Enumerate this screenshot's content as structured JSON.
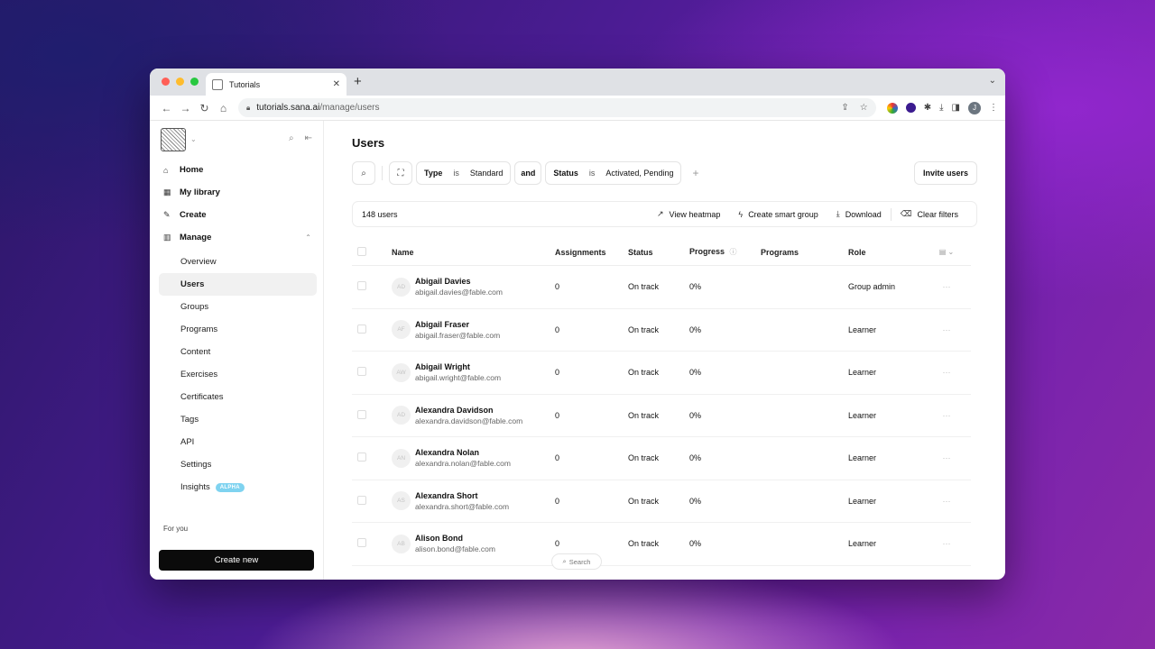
{
  "browser": {
    "tab_title": "Tutorials",
    "url_host": "tutorials.sana.ai",
    "url_path": "/manage/users",
    "profile_initial": "J"
  },
  "sidebar": {
    "nav": [
      {
        "label": "Home",
        "icon": "home-icon"
      },
      {
        "label": "My library",
        "icon": "library-icon"
      },
      {
        "label": "Create",
        "icon": "pencil-icon"
      },
      {
        "label": "Manage",
        "icon": "manage-icon"
      }
    ],
    "manage_items": [
      "Overview",
      "Users",
      "Groups",
      "Programs",
      "Content",
      "Exercises",
      "Certificates",
      "Tags",
      "API",
      "Settings",
      "Insights"
    ],
    "insights_badge": "ALPHA",
    "for_you": "For you",
    "create_new": "Create new"
  },
  "main": {
    "title": "Users",
    "filters": {
      "type_field": "Type",
      "type_op": "is",
      "type_value": "Standard",
      "conjunction": "and",
      "status_field": "Status",
      "status_op": "is",
      "status_value": "Activated, Pending"
    },
    "invite": "Invite users",
    "count": "148 users",
    "actions": [
      "View heatmap",
      "Create smart group",
      "Download",
      "Clear filters"
    ],
    "columns": [
      "Name",
      "Assignments",
      "Status",
      "Progress",
      "Programs",
      "Role"
    ],
    "rows": [
      {
        "initials": "AD",
        "name": "Abigail Davies",
        "email": "abigail.davies@fable.com",
        "assignments": "0",
        "status": "On track",
        "progress": "0%",
        "programs": "",
        "role": "Group admin"
      },
      {
        "initials": "AF",
        "name": "Abigail Fraser",
        "email": "abigail.fraser@fable.com",
        "assignments": "0",
        "status": "On track",
        "progress": "0%",
        "programs": "",
        "role": "Learner"
      },
      {
        "initials": "AW",
        "name": "Abigail Wright",
        "email": "abigail.wright@fable.com",
        "assignments": "0",
        "status": "On track",
        "progress": "0%",
        "programs": "",
        "role": "Learner"
      },
      {
        "initials": "AD",
        "name": "Alexandra Davidson",
        "email": "alexandra.davidson@fable.com",
        "assignments": "0",
        "status": "On track",
        "progress": "0%",
        "programs": "",
        "role": "Learner"
      },
      {
        "initials": "AN",
        "name": "Alexandra Nolan",
        "email": "alexandra.nolan@fable.com",
        "assignments": "0",
        "status": "On track",
        "progress": "0%",
        "programs": "",
        "role": "Learner"
      },
      {
        "initials": "AS",
        "name": "Alexandra Short",
        "email": "alexandra.short@fable.com",
        "assignments": "0",
        "status": "On track",
        "progress": "0%",
        "programs": "",
        "role": "Learner"
      },
      {
        "initials": "AB",
        "name": "Alison Bond",
        "email": "alison.bond@fable.com",
        "assignments": "0",
        "status": "On track",
        "progress": "0%",
        "programs": "",
        "role": "Learner"
      }
    ],
    "search_pill": "Search"
  }
}
